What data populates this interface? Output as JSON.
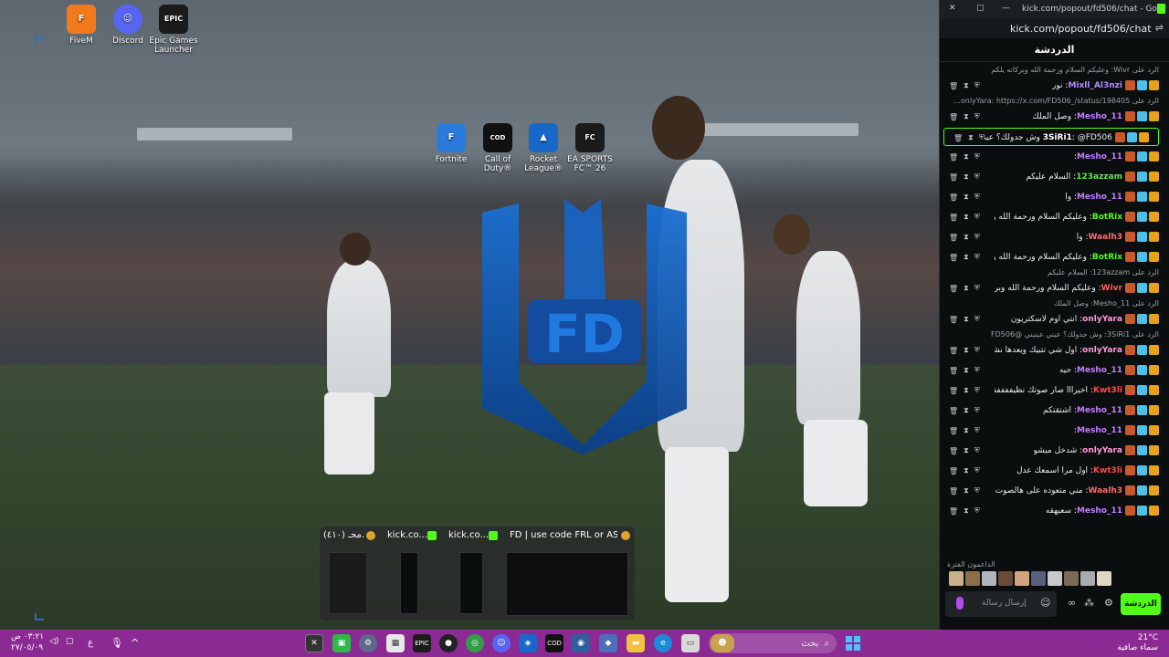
{
  "desktop": {
    "top_icons": [
      {
        "label": "FiveM",
        "icon": "fivem-icon",
        "color": "#f07a1c"
      },
      {
        "label": "Discord",
        "icon": "discord-icon",
        "color": "#5865f2"
      },
      {
        "label": "Epic Games Launcher",
        "icon": "epic-games-icon",
        "color": "#1b1b1b"
      }
    ],
    "game_icons": [
      {
        "label": "Fortnite",
        "icon": "fortnite-icon",
        "color": "#2b7bdc"
      },
      {
        "label": "Call of Duty®",
        "icon": "call-of-duty-icon",
        "color": "#111111"
      },
      {
        "label": "Rocket League®",
        "icon": "rocket-league-icon",
        "color": "#1868c9"
      },
      {
        "label": "EA SPORTS FC™ 26",
        "icon": "ea-fc-icon",
        "color": "#1b1b1b"
      }
    ],
    "logo_text": "FD"
  },
  "task_view": {
    "items": [
      {
        "title": "(٤١٠) محـ...",
        "badge_color": "#e2a12d"
      },
      {
        "title": "kick.co...",
        "badge_color": "#53fc18"
      },
      {
        "title": "kick.co...",
        "badge_color": "#53fc18"
      },
      {
        "title": "FD | use code FRL or AS ()...",
        "badge_color": "#e2a12d"
      }
    ]
  },
  "taskbar": {
    "search_placeholder": "بحث",
    "weather_temp": "21°C",
    "weather_desc": "سماء صافية",
    "time": "٠٣:٢١ ص",
    "date": "٢٧/٠٥/٠٩",
    "lang": "ع"
  },
  "chat": {
    "window_title": "kick.com/popout/fd506/chat - Google...",
    "url": "kick.com/popout/fd506/chat",
    "header": "الدردشة",
    "messages": [
      {
        "reply": "الرد على Wivr: وعليكم السلام ورحمة الله وبركاته يلكم",
        "user": "Mixll_Al3nzi",
        "text": "نور",
        "user_color": "#b48cff"
      },
      {
        "reply": "الرد على onlyYara: https://x.com/FD506_/status/198405...",
        "user": "Mesho_11",
        "text": "وصل الملك",
        "user_color": "#c57cff"
      },
      {
        "user": "3SiRi1",
        "text": "@FD506 وش جدولك؟ عيني عينيني",
        "user_color": "#ffffff",
        "highlight": true
      },
      {
        "user": "Mesho_11",
        "text": "",
        "user_color": "#c57cff"
      },
      {
        "user": "123azzam",
        "text": "السلام عليكم",
        "user_color": "#6be05d"
      },
      {
        "user": "Mesho_11",
        "text": "وا",
        "user_color": "#c57cff"
      },
      {
        "user": "BotRix",
        "text": "وعليكم السلام ورحمة الله وبركاته حياك",
        "user_color": "#53fc18"
      },
      {
        "user": "Waalh3",
        "text": "وا",
        "user_color": "#ff6b6b"
      },
      {
        "user": "BotRix",
        "text": "وعليكم السلام ورحمة الله وبركاته حياك",
        "user_color": "#53fc18"
      },
      {
        "reply": "الرد على 123azzam: السلام عليكم",
        "user": "Wivr",
        "text": "وعليكم السلام ورحمة الله وبركاته يلكم",
        "user_color": "#ff5e5e"
      },
      {
        "reply": "الرد على Mesho_11: وصل الملك",
        "user": "onlyYara",
        "text": "انتي اوم لاسكتريون",
        "user_color": "#ff9ad5"
      },
      {
        "reply": "الرد على 3SiRi1: وش جدولك؟ عيني عينيني @FD506",
        "user": "onlyYara",
        "text": "اول شي تتبيك ويعدها نشوف",
        "user_color": "#ff9ad5"
      },
      {
        "user": "Mesho_11",
        "text": "حيه",
        "user_color": "#c57cff"
      },
      {
        "user": "Kwt3li",
        "text": "اخيرااا صار صوتك نظيفففففف",
        "user_color": "#ff4b4b"
      },
      {
        "user": "Mesho_11",
        "text": "اشتقتكم",
        "user_color": "#c57cff"
      },
      {
        "user": "Mesho_11",
        "text": "",
        "user_color": "#c57cff"
      },
      {
        "user": "onlyYara",
        "text": "شدخل ميشو",
        "user_color": "#ff9ad5"
      },
      {
        "user": "Kwt3li",
        "text": "اول مرا اسمعك عدل",
        "user_color": "#ff4b4b"
      },
      {
        "user": "Waalh3",
        "text": "مني متعوده على هالصوت اين",
        "user_color": "#ff6b6b"
      },
      {
        "user": "Mesho_11",
        "text": "سعيهقه",
        "user_color": "#c57cff"
      }
    ],
    "top_supporters_label": "الداعمون الفترة",
    "input_placeholder": "إرسال رسالة",
    "send_label": "الدردشة"
  }
}
